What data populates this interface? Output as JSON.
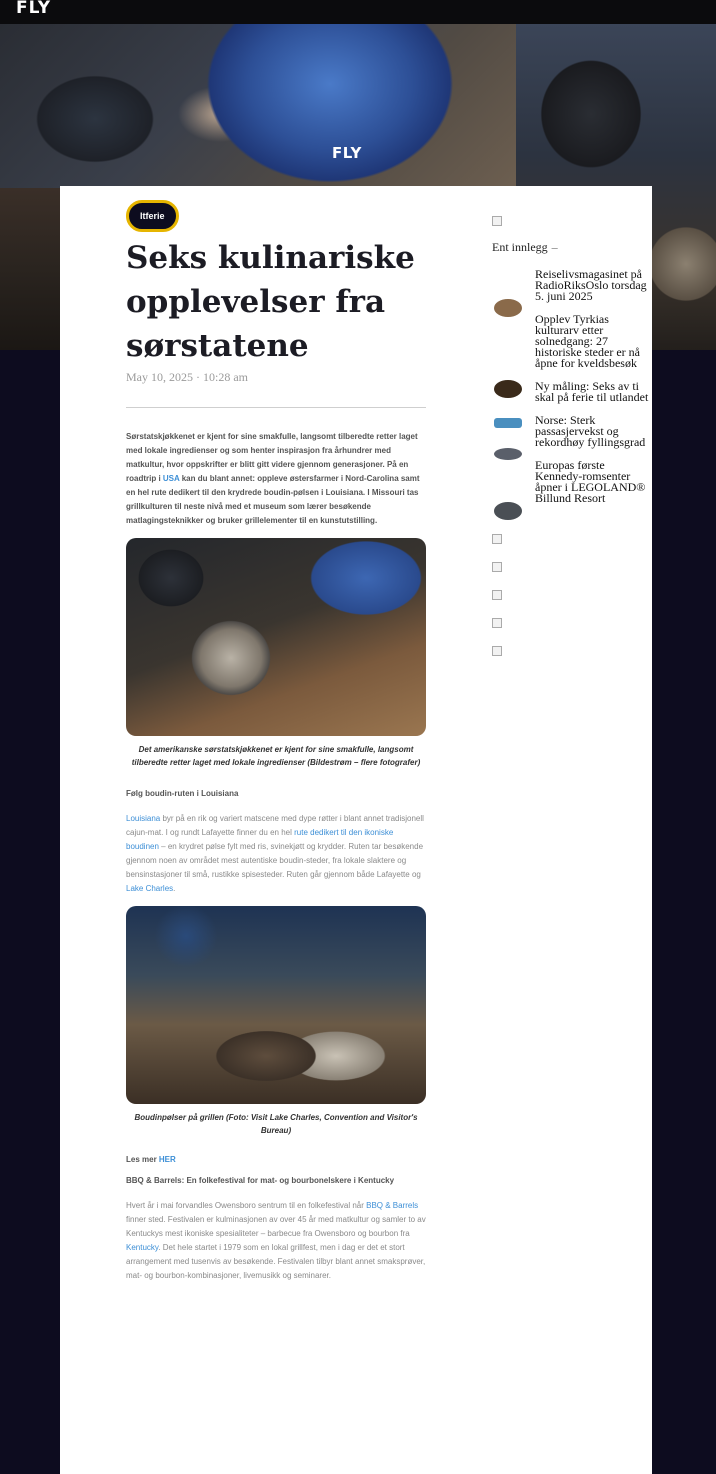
{
  "topbar": {
    "logo": "FLY"
  },
  "hero": {
    "brand": "FLY"
  },
  "article": {
    "category": "Itferie",
    "title": "Seks kulinariske opplevelser fra sørstatene",
    "date": "May 10, 2025 · 10:28 am",
    "intro_1": "Sørstatskjøkkenet er kjent for sine smakfulle, langsomt tilberedte retter laget med lokale ingredienser og som henter inspirasjon fra århundrer med matkultur, hvor oppskrifter er blitt gitt videre gjennom generasjoner. På en roadtrip i ",
    "intro_link": "USA",
    "intro_2": " kan du blant annet: oppleve østersfarmer i Nord-Carolina samt en hel rute dedikert til den krydrede boudin-pølsen i Louisiana. I Missouri tas grillkulturen til neste nivå med et museum som lærer besøkende matlagingsteknikker og bruker grillelementer til en kunstutstilling.",
    "caption_1": "Det amerikanske sørstatskjøkkenet er kjent for sine smakfulle, langsomt tilberedte retter laget med lokale ingredienser (Bildestrøm – flere fotografer)",
    "subhead_1": "Følg boudin-ruten i Louisiana",
    "p1_link1": "Louisiana",
    "p1_t1": " byr på en rik og variert matscene med dype røtter i blant annet tradisjonell cajun-mat. I og rundt Lafayette finner du en hel ",
    "p1_link2": "rute dedikert til den ikoniske boudinen",
    "p1_t2": " – en krydret pølse fylt med ris, svinekjøtt og krydder. Ruten tar besøkende gjennom noen av området mest autentiske boudin-steder, fra lokale slaktere og bensinstasjoner til små, rustikke spisesteder. Ruten går gjennom både Lafayette og ",
    "p1_link3": "Lake Charles",
    "p1_t3": ".",
    "caption_2": "Boudinpølser på grillen (Foto: Visit Lake Charles, Convention and Visitor's Bureau)",
    "lesmer_label": "Les mer ",
    "lesmer_link": "HER",
    "subhead_2": "BBQ & Barrels: En folkefestival for mat- og bourbonelskere i Kentucky",
    "p2_t1": "Hvert år i mai forvandles Owensboro sentrum til en folkefestival når ",
    "p2_link1": "BBQ & Barrels",
    "p2_t2": " finner sted. Festivalen er kulminasjonen av over 45 år med matkultur og samler to av Kentuckys mest ikoniske spesialiteter – barbecue fra Owensboro og bourbon fra ",
    "p2_link2": "Kentucky",
    "p2_t3": ". Det hele startet i 1979 som en lokal grillfest, men i dag er det et stort arrangement med tusenvis av besøkende. Festivalen tilbyr blant annet smaksprøver, mat- og bourbon-kombinasjoner, livemusikk og seminarer."
  },
  "sidebar": {
    "heading": "Ent innlegg",
    "dash": "–",
    "posts": [
      {
        "title": "Reiselivsmagasinet på RadioRiksOslo torsdag 5. juni 2025",
        "thumb_color": "#8a6a4a"
      },
      {
        "title": "Opplev Tyrkias kulturarv etter solnedgang: 27 historiske steder er nå åpne for kveldsbesøk",
        "thumb_color": "#3a2a1a"
      },
      {
        "title": "Ny måling: Seks av ti skal på ferie til utlandet",
        "thumb_color": "#4a8fbf"
      },
      {
        "title": "Norse: Sterk passasjervekst og rekordhøy fyllingsgrad",
        "thumb_color": "#5a5f6a"
      },
      {
        "title": "Europas første Kennedy-romsenter åpner i LEGOLAND® Billund Resort",
        "thumb_color": "#4a4f55"
      }
    ]
  }
}
